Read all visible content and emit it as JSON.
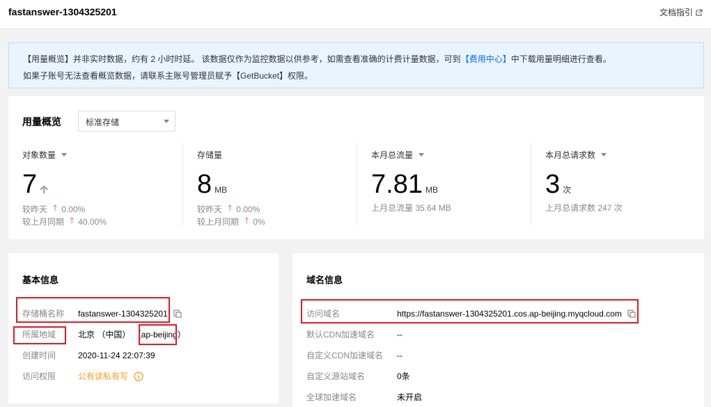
{
  "header": {
    "title": "fastanswer-1304325201",
    "doc_link": "文档指引"
  },
  "notice": {
    "line1_pre": "【用量概览】并非实时数据，约有 2 小时时延。 该数据仅作为监控数据以供参考，如需查看准确的计费计量数据，可到",
    "line1_link": "【费用中心】",
    "line1_post": "中下载用量明细进行查看。",
    "line2": "如果子账号无法查看概览数据，请联系主账号管理员赋予【GetBucket】权限。"
  },
  "usage": {
    "label": "用量概览",
    "select_value": "标准存储",
    "metrics": [
      {
        "title": "对象数量",
        "dropdown": true,
        "value": "7",
        "unit": "个",
        "sub1_label": "较昨天",
        "sub1_pct": "0.00%",
        "sub2_label": "较上月同期",
        "sub2_pct": "40.00%"
      },
      {
        "title": "存储量",
        "dropdown": false,
        "value": "8",
        "unit": "MB",
        "sub1_label": "较昨天",
        "sub1_pct": "0.00%",
        "sub2_label": "较上月同期",
        "sub2_pct": "0%"
      },
      {
        "title": "本月总流量",
        "dropdown": true,
        "value": "7.81",
        "unit": "MB",
        "sub1_text": "上月总流量 35.64 MB"
      },
      {
        "title": "本月总请求数",
        "dropdown": true,
        "value": "3",
        "unit": "次",
        "sub1_text": "上月总请求数 247 次"
      }
    ]
  },
  "basic": {
    "title": "基本信息",
    "rows": [
      {
        "key": "存储桶名称",
        "value": "fastanswer-1304325201"
      },
      {
        "key": "所属地域",
        "value": "北京 （中国） （ap-beijing）"
      },
      {
        "key": "创建时间",
        "value": "2020-11-24 22:07:39"
      },
      {
        "key": "访问权限",
        "value": "公有读私有写"
      }
    ]
  },
  "domain": {
    "title": "域名信息",
    "rows": [
      {
        "key": "访问域名",
        "value": "https://fastanswer-1304325201.cos.ap-beijing.myqcloud.com"
      },
      {
        "key": "默认CDN加速域名",
        "value": "--"
      },
      {
        "key": "自定义CDN加速域名",
        "value": "--"
      },
      {
        "key": "自定义源站域名",
        "value": "0条"
      },
      {
        "key": "全球加速域名",
        "value": "未开启"
      }
    ]
  },
  "colors": {
    "accent": "#006eff",
    "warning": "#ff9c19",
    "highlight_box": "#e4181f",
    "up_arrow": "#e54545"
  }
}
